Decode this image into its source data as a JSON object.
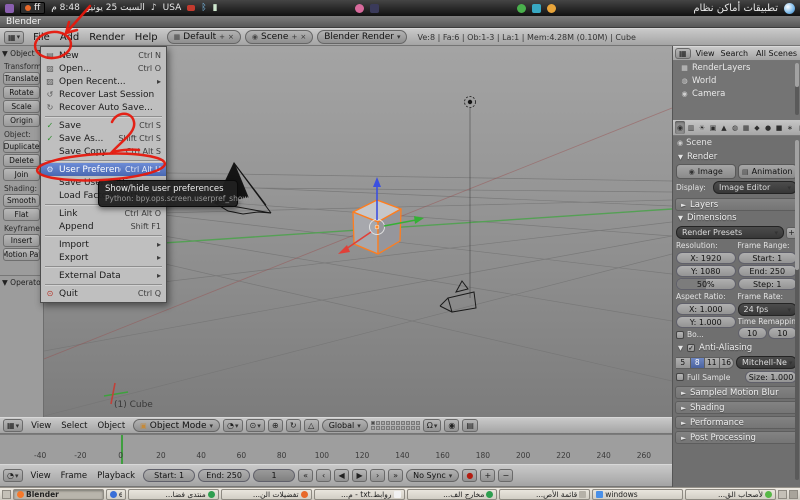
{
  "icons": {
    "dd": "▾",
    "tri_open": "▼",
    "tri_closed": "►",
    "submenu": "▸",
    "editor_grid": "▦",
    "plus": "+",
    "close": "×",
    "check": "✓",
    "volume": "♪",
    "bluetooth": "ᛒ",
    "battery": "▮",
    "cube": "▣",
    "sphere": "◔",
    "pivot": "⊙",
    "translate": "⊕",
    "rotate": "↻",
    "scale": "△",
    "magnet": "Ω",
    "camera": "◉",
    "clapper": "▤",
    "scene": "◉",
    "clock": "◔",
    "record": "●",
    "key_add": "+",
    "key_del": "−",
    "jump_start": "«",
    "prev_key": "‹",
    "play_rev": "◀",
    "play": "▶",
    "next_key": "›",
    "jump_end": "»"
  },
  "os_bar": {
    "window_button": "ff",
    "time": "8:48 م",
    "date": "السبت 25 يونيو",
    "keyboard": "USA",
    "system_menus": "تطبيقات أماكن نظام"
  },
  "window": {
    "title": "Blender"
  },
  "info": {
    "menus": [
      "File",
      "Add",
      "Render",
      "Help"
    ],
    "layout": "Default",
    "scene": "Scene",
    "engine": "Blender Render",
    "stats": "Ve:8 | Fa:6 | Ob:1-3 | La:1 | Mem:4.28M (0.10M) | Cube"
  },
  "file_menu": {
    "items": [
      {
        "label": "New",
        "shortcut": "Ctrl N",
        "icon": "▤",
        "cls": ""
      },
      {
        "label": "Open...",
        "shortcut": "Ctrl O",
        "icon": "▨",
        "cls": ""
      },
      {
        "label": "Open Recent...",
        "shortcut": "▸",
        "icon": "▨",
        "cls": ""
      },
      {
        "label": "Recover Last Session",
        "shortcut": "",
        "icon": "↺",
        "cls": ""
      },
      {
        "label": "Recover Auto Save...",
        "shortcut": "",
        "icon": "↻",
        "cls": ""
      },
      {
        "label": "",
        "shortcut": "",
        "icon": "",
        "cls": "sep"
      },
      {
        "label": "Save",
        "shortcut": "Ctrl S",
        "icon": "✓",
        "cls": "has-check"
      },
      {
        "label": "Save As...",
        "shortcut": "Shift Ctrl S",
        "icon": "✓",
        "cls": "has-check"
      },
      {
        "label": "Save Copy...",
        "shortcut": "Ctrl Alt S",
        "icon": "",
        "cls": ""
      },
      {
        "label": "",
        "shortcut": "",
        "icon": "",
        "cls": "sep"
      },
      {
        "label": "User Preferences",
        "shortcut": "Ctrl Alt U",
        "icon": "⚙",
        "cls": "hl"
      },
      {
        "label": "Save User Settings",
        "shortcut": "",
        "icon": "",
        "cls": ""
      },
      {
        "label": "Load Factory Settings",
        "shortcut": "",
        "icon": "",
        "cls": ""
      },
      {
        "label": "",
        "shortcut": "",
        "icon": "",
        "cls": "sep"
      },
      {
        "label": "Link",
        "shortcut": "Ctrl Alt O",
        "icon": "",
        "cls": ""
      },
      {
        "label": "Append",
        "shortcut": "Shift F1",
        "icon": "",
        "cls": ""
      },
      {
        "label": "",
        "shortcut": "",
        "icon": "",
        "cls": "sep"
      },
      {
        "label": "Import",
        "shortcut": "▸",
        "icon": "",
        "cls": ""
      },
      {
        "label": "Export",
        "shortcut": "▸",
        "icon": "",
        "cls": ""
      },
      {
        "label": "",
        "shortcut": "",
        "icon": "",
        "cls": "sep"
      },
      {
        "label": "External Data",
        "shortcut": "▸",
        "icon": "",
        "cls": ""
      },
      {
        "label": "",
        "shortcut": "",
        "icon": "",
        "cls": "sep"
      },
      {
        "label": "Quit",
        "shortcut": "Ctrl Q",
        "icon": "⊙",
        "cls": "quit"
      }
    ],
    "tooltip_title": "Show/hide user preferences",
    "tooltip_python": "Python: bpy.ops.screen.userpref_show()"
  },
  "tool_shelf": {
    "panel_title": "Object T..",
    "rows": [
      {
        "label": "Transform:",
        "cls": "lbl"
      },
      {
        "label": "Translate",
        "cls": "btn"
      },
      {
        "label": "Rotate",
        "cls": "btn"
      },
      {
        "label": "Scale",
        "cls": "btn"
      },
      {
        "label": "Origin",
        "cls": "btn"
      },
      {
        "label": "Object:",
        "cls": "lbl"
      },
      {
        "label": "Duplicate",
        "cls": "btn"
      },
      {
        "label": "Delete",
        "cls": "btn"
      },
      {
        "label": "Join",
        "cls": "btn"
      },
      {
        "label": "Shading:",
        "cls": "lbl"
      },
      {
        "label": "Smooth",
        "cls": "btn"
      },
      {
        "label": "Flat",
        "cls": "btn"
      },
      {
        "label": "Keyframes:",
        "cls": "lbl"
      },
      {
        "label": "Insert",
        "cls": "btn"
      },
      {
        "label": "Motion Pat",
        "cls": "btn"
      }
    ],
    "operator_title": "Operator"
  },
  "viewport": {
    "object_label": "(1) Cube"
  },
  "view3d_header": {
    "menus": [
      "View",
      "Select",
      "Object"
    ],
    "mode": "Object Mode",
    "orientation": "Global"
  },
  "timeline": {
    "ruler": [
      "-40",
      "-20",
      "0",
      "20",
      "40",
      "60",
      "80",
      "100",
      "120",
      "140",
      "160",
      "180",
      "200",
      "220",
      "240",
      "260"
    ],
    "menus": [
      "View",
      "Frame",
      "Playback"
    ],
    "start": "Start: 1",
    "end": "End: 250",
    "current": "1",
    "sync": "No Sync"
  },
  "outliner": {
    "menus": [
      "View",
      "Search"
    ],
    "scope": "All Scenes",
    "rows": [
      {
        "label": "RenderLayers",
        "icon": "▦"
      },
      {
        "label": "World",
        "icon": "◍"
      },
      {
        "label": "Camera",
        "icon": "◉"
      }
    ]
  },
  "properties": {
    "tab_icons": [
      {
        "g": "◉",
        "cls": "on"
      },
      {
        "g": "▥"
      },
      {
        "g": "☀"
      },
      {
        "g": "▣"
      },
      {
        "g": "▲"
      },
      {
        "g": "◍"
      },
      {
        "g": "▦"
      },
      {
        "g": "◆"
      },
      {
        "g": "●"
      },
      {
        "g": "■"
      },
      {
        "g": "∗"
      },
      {
        "g": "▮"
      }
    ],
    "breadcrumb": "Scene",
    "render": {
      "title": "Render",
      "image": "Image",
      "animation": "Animation",
      "display_label": "Display:",
      "display_value": "Image Editor"
    },
    "layers": "Layers",
    "dimensions": {
      "title": "Dimensions",
      "presets": "Render Presets",
      "resolution_label": "Resolution:",
      "frame_range_label": "Frame Range:",
      "res_x": "X: 1920",
      "res_y": "Y: 1080",
      "res_pct": "50%",
      "fr_start": "Start: 1",
      "fr_end": "End: 250",
      "fr_step": "Step: 1",
      "aspect_label": "Aspect Ratio:",
      "fps_label": "Frame Rate:",
      "asp_x": "X: 1.000",
      "asp_y": "Y: 1.000",
      "fps": "24 fps",
      "border": "Bo...",
      "remap_label": "Time Remappin",
      "remap_old": "10",
      "remap_new": "10"
    },
    "aa": {
      "title": "Anti-Aliasing",
      "samples": [
        {
          "label": "5",
          "cls": ""
        },
        {
          "label": "8",
          "cls": "on"
        },
        {
          "label": "11",
          "cls": ""
        },
        {
          "label": "16",
          "cls": ""
        }
      ],
      "filter": "Mitchell-Ne",
      "full_sample": "Full Sample",
      "size": "Size: 1.000"
    },
    "collapsed": [
      "Sampled Motion Blur",
      "Shading",
      "Performance",
      "Post Processing"
    ]
  },
  "taskbar": {
    "items": [
      {
        "label": "Blender",
        "cls": "active ic-blender"
      },
      {
        "label": "e",
        "cls": "small ic-e"
      },
      {
        "label": "منتدى فضا...",
        "cls": "rtl ic-globe"
      },
      {
        "label": "تفضيلات الن...",
        "cls": "rtl ic-ff"
      },
      {
        "label": "روابط.txt - م...",
        "cls": "rtl ic-txt"
      },
      {
        "label": "مخارج الف...",
        "cls": "rtl ic-globe"
      },
      {
        "label": "قائمة الأص...",
        "cls": "rtl ic-list"
      },
      {
        "label": "windows",
        "cls": "ic-win"
      },
      {
        "label": "لأصحاب الق...",
        "cls": "rtl ic-green"
      }
    ]
  }
}
